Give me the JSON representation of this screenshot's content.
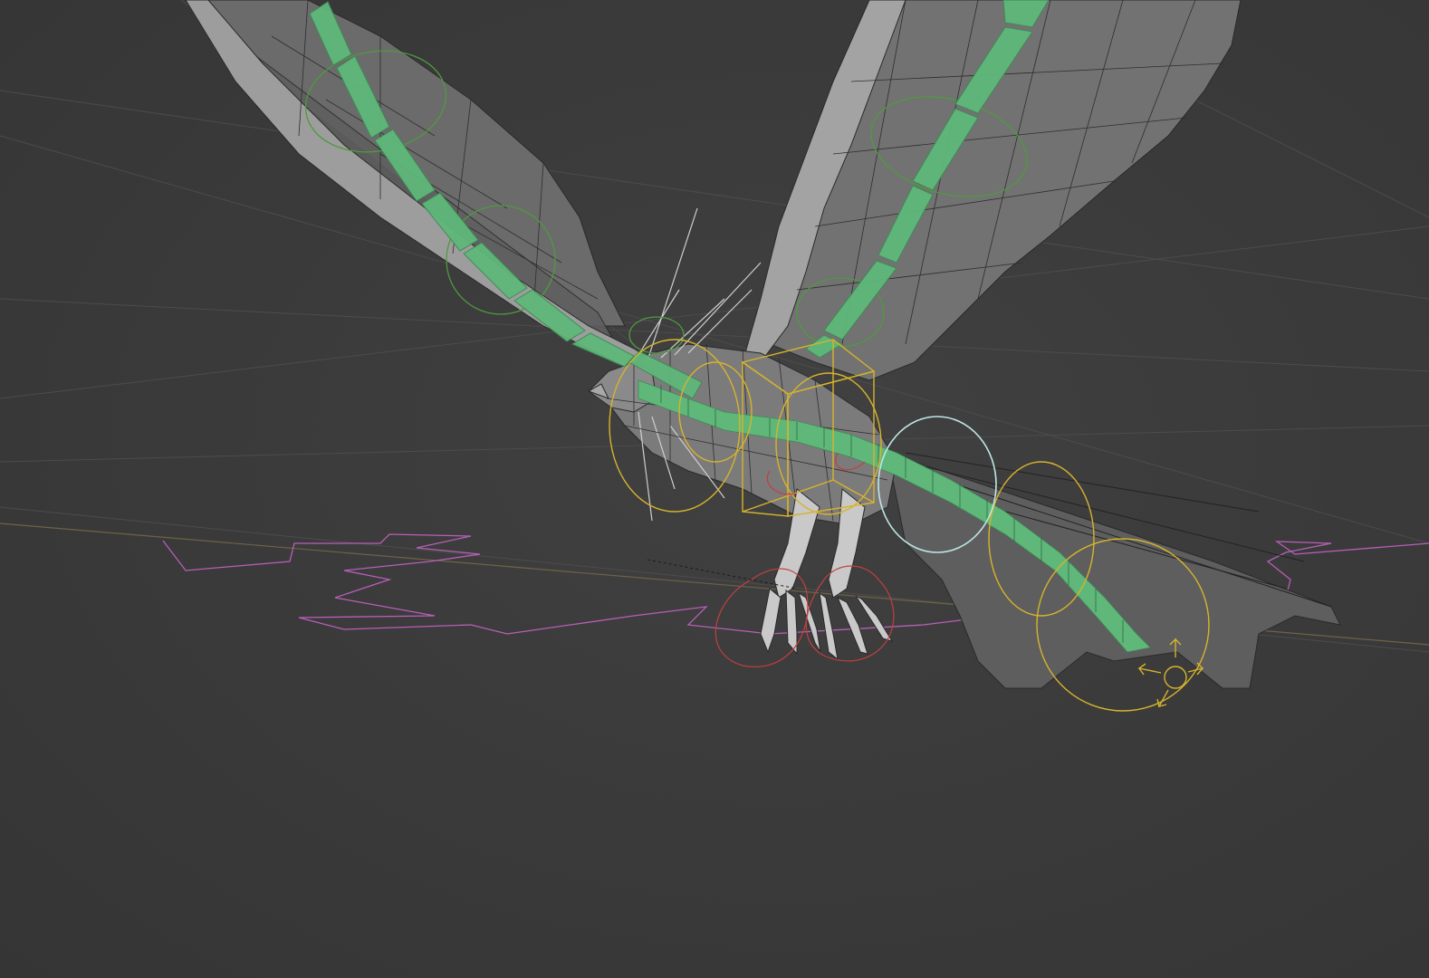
{
  "viewport": {
    "name": "3D Viewport",
    "background": "#3a3a3a",
    "grid_color": "#4c4c4c",
    "x_axis_color": "#7a6a4a",
    "mesh_fill": "#6f6f6f",
    "mesh_fill_dark": "#555555",
    "mesh_wire": "#2a2a2a",
    "mesh_edge_light": "#a9a9a9",
    "bone_color": "#5fb87a",
    "bone_edge": "#3f8a55",
    "control_green": "#4e9a3e",
    "control_yellow": "#d7b32c",
    "control_red": "#c24040",
    "control_cyan": "#bfe6e6",
    "motion_path_color": "#b85fb8"
  },
  "scene": {
    "object": "armature-rigged-bird",
    "icons": [
      "move-gizmo-icon"
    ]
  }
}
